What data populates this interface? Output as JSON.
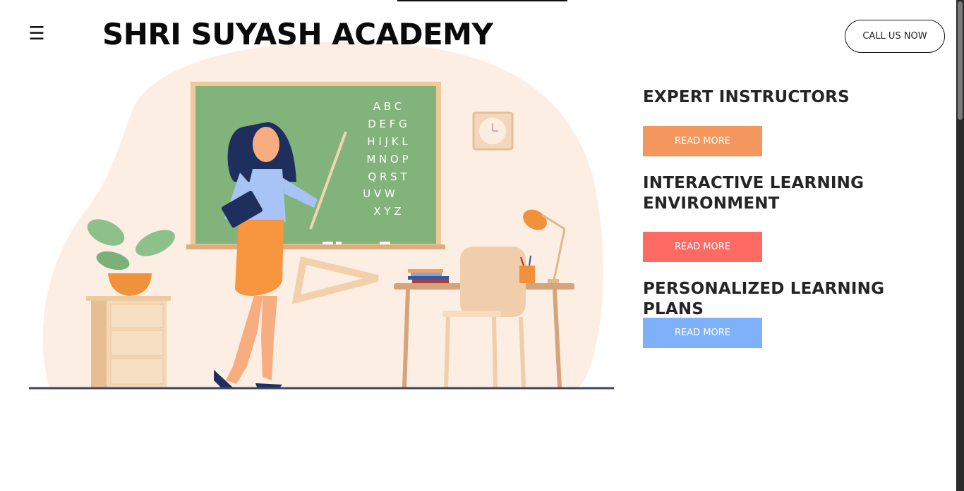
{
  "header": {
    "menu_icon": "hamburger-menu-icon",
    "menu_glyph": "☰",
    "title": "SHRI SUYASH ACADEMY",
    "call_button": "CALL US NOW"
  },
  "illustration": {
    "board_letters": [
      "A B C",
      "D E F G",
      "H I J K L",
      "M N O P",
      "Q R S T",
      "U V W",
      "X Y Z"
    ]
  },
  "features": [
    {
      "title": "EXPERT INSTRUCTORS",
      "button": "READ MORE",
      "color": "#f4975f"
    },
    {
      "title_line1": "INTERACTIVE LEARNING",
      "title_line2": "ENVIRONMENT",
      "button": "READ MORE",
      "color": "#ff6b63"
    },
    {
      "title": "PERSONALIZED LEARNING PLANS",
      "button": "READ MORE",
      "color": "#7fb1fb"
    }
  ]
}
